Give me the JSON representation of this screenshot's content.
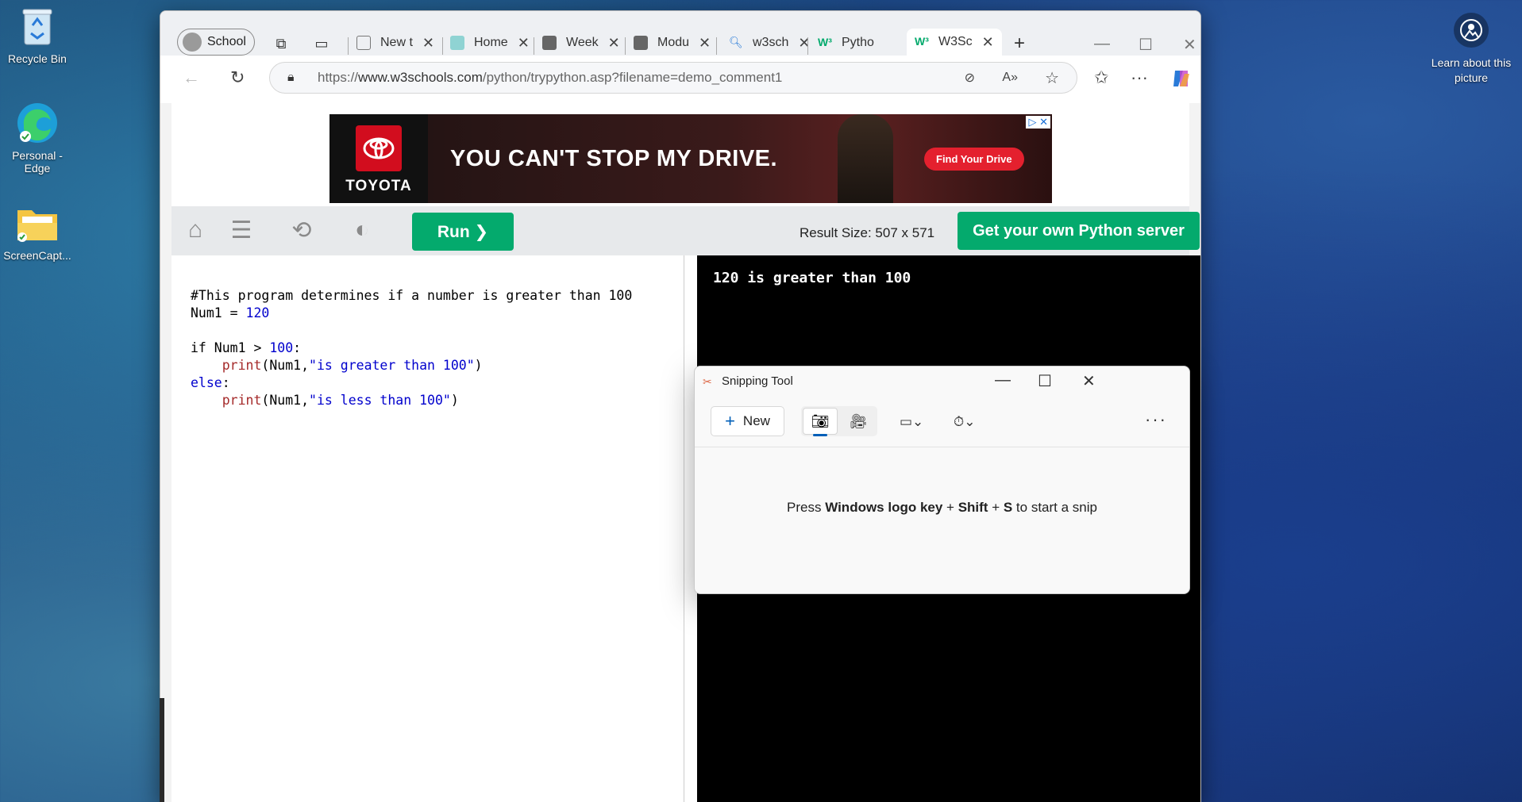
{
  "desktop": {
    "icons": [
      {
        "label": "Recycle Bin"
      },
      {
        "label": "Personal - Edge"
      },
      {
        "label": "ScreenCapt..."
      }
    ],
    "learn_label": "Learn about this picture"
  },
  "browser": {
    "profile_label": "School",
    "tabs": [
      {
        "label": "New t"
      },
      {
        "label": "Home"
      },
      {
        "label": "Week"
      },
      {
        "label": "Modu"
      },
      {
        "label": "w3sch"
      },
      {
        "label": "Pytho"
      },
      {
        "label": "W3Sc"
      }
    ],
    "url": {
      "prefix": "https://",
      "host": "www.w3schools.com",
      "path": "/python/trypython.asp?filename=demo_comment1"
    }
  },
  "ad": {
    "brand": "TOYOTA",
    "headline": "YOU CAN'T STOP MY DRIVE.",
    "cta": "Find Your Drive",
    "adchoice": "▷ ✕"
  },
  "toolbar": {
    "run_label": "Run ❯",
    "result_size": "Result Size: 507 x 571",
    "get_server": "Get your own Python server"
  },
  "editor": {
    "lines": [
      "#This program determines if a number is greater than 100",
      "Num1 = 120",
      "",
      "if Num1 > 100:",
      "    print(Num1,\"is greater than 100\")",
      "else:",
      "    print(Num1,\"is less than 100\")"
    ]
  },
  "output": {
    "text": "120 is greater than 100"
  },
  "snipping_tool": {
    "title": "Snipping Tool",
    "new_label": "New",
    "hint_prefix": "Press ",
    "hint_key1": "Windows logo key",
    "hint_plus1": " + ",
    "hint_key2": "Shift",
    "hint_plus2": " + ",
    "hint_key3": "S",
    "hint_suffix": " to start a snip"
  }
}
